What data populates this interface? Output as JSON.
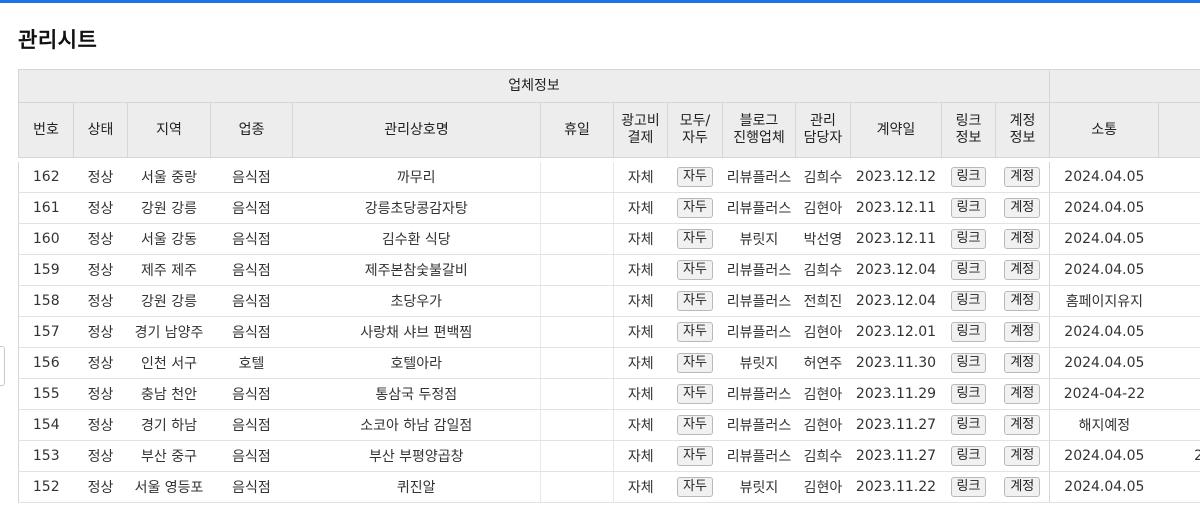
{
  "page": {
    "title": "관리시트"
  },
  "table": {
    "group_header": "업체정보",
    "columns": {
      "no": "번호",
      "status": "상태",
      "region": "지역",
      "category": "업종",
      "name": "관리상호명",
      "holiday": "휴일",
      "ad_line1": "광고비",
      "ad_line2": "결제",
      "type_line1": "모두/",
      "type_line2": "자두",
      "blog_line1": "블로그",
      "blog_line2": "진행업체",
      "mgr_line1": "관리",
      "mgr_line2": "담당자",
      "contract": "계약일",
      "link_line1": "링크",
      "link_line2": "정보",
      "acct_line1": "계정",
      "acct_line2": "정보",
      "comm": "소통"
    },
    "rows": [
      {
        "no": "162",
        "status": "정상",
        "region": "서울 중랑",
        "category": "음식점",
        "name": "까무리",
        "holiday": "",
        "ad": "자체",
        "type": "자두",
        "blog": "리뷰플러스",
        "manager": "김희수",
        "contract": "2023.12.12",
        "link": "링크",
        "account": "계정",
        "comm": "2024.04.05",
        "extra": ""
      },
      {
        "no": "161",
        "status": "정상",
        "region": "강원 강릉",
        "category": "음식점",
        "name": "강릉초당콩감자탕",
        "holiday": "",
        "ad": "자체",
        "type": "자두",
        "blog": "리뷰플러스",
        "manager": "김현아",
        "contract": "2023.12.11",
        "link": "링크",
        "account": "계정",
        "comm": "2024.04.05",
        "extra": ""
      },
      {
        "no": "160",
        "status": "정상",
        "region": "서울 강동",
        "category": "음식점",
        "name": "김수환 식당",
        "holiday": "",
        "ad": "자체",
        "type": "자두",
        "blog": "뷰릿지",
        "manager": "박선영",
        "contract": "2023.12.11",
        "link": "링크",
        "account": "계정",
        "comm": "2024.04.05",
        "extra": ""
      },
      {
        "no": "159",
        "status": "정상",
        "region": "제주 제주",
        "category": "음식점",
        "name": "제주본참숯불갈비",
        "holiday": "",
        "ad": "자체",
        "type": "자두",
        "blog": "리뷰플러스",
        "manager": "김희수",
        "contract": "2023.12.04",
        "link": "링크",
        "account": "계정",
        "comm": "2024.04.05",
        "extra": ""
      },
      {
        "no": "158",
        "status": "정상",
        "region": "강원 강릉",
        "category": "음식점",
        "name": "초당우가",
        "holiday": "",
        "ad": "자체",
        "type": "자두",
        "blog": "리뷰플러스",
        "manager": "전희진",
        "contract": "2023.12.04",
        "link": "링크",
        "account": "계정",
        "comm": "홈페이지유지",
        "extra": ""
      },
      {
        "no": "157",
        "status": "정상",
        "region": "경기 남양주",
        "category": "음식점",
        "name": "사랑채 샤브 편백찜",
        "holiday": "",
        "ad": "자체",
        "type": "자두",
        "blog": "리뷰플러스",
        "manager": "김현아",
        "contract": "2023.12.01",
        "link": "링크",
        "account": "계정",
        "comm": "2024.04.05",
        "extra": ""
      },
      {
        "no": "156",
        "status": "정상",
        "region": "인천 서구",
        "category": "호텔",
        "name": "호텔아라",
        "holiday": "",
        "ad": "자체",
        "type": "자두",
        "blog": "뷰릿지",
        "manager": "허연주",
        "contract": "2023.11.30",
        "link": "링크",
        "account": "계정",
        "comm": "2024.04.05",
        "extra": ""
      },
      {
        "no": "155",
        "status": "정상",
        "region": "충남 천안",
        "category": "음식점",
        "name": "통삼국 두정점",
        "holiday": "",
        "ad": "자체",
        "type": "자두",
        "blog": "리뷰플러스",
        "manager": "김현아",
        "contract": "2023.11.29",
        "link": "링크",
        "account": "계정",
        "comm": "2024-04-22",
        "extra": ""
      },
      {
        "no": "154",
        "status": "정상",
        "region": "경기 하남",
        "category": "음식점",
        "name": "소코아 하남 감일점",
        "holiday": "",
        "ad": "자체",
        "type": "자두",
        "blog": "리뷰플러스",
        "manager": "김현아",
        "contract": "2023.11.27",
        "link": "링크",
        "account": "계정",
        "comm": "해지예정",
        "extra": ""
      },
      {
        "no": "153",
        "status": "정상",
        "region": "부산 중구",
        "category": "음식점",
        "name": "부산 부평양곱창",
        "holiday": "",
        "ad": "자체",
        "type": "자두",
        "blog": "리뷰플러스",
        "manager": "김희수",
        "contract": "2023.11.27",
        "link": "링크",
        "account": "계정",
        "comm": "2024.04.05",
        "extra": "2"
      },
      {
        "no": "152",
        "status": "정상",
        "region": "서울 영등포",
        "category": "음식점",
        "name": "퀴진알",
        "holiday": "",
        "ad": "자체",
        "type": "자두",
        "blog": "뷰릿지",
        "manager": "김현아",
        "contract": "2023.11.22",
        "link": "링크",
        "account": "계정",
        "comm": "2024.04.05",
        "extra": ""
      }
    ]
  }
}
